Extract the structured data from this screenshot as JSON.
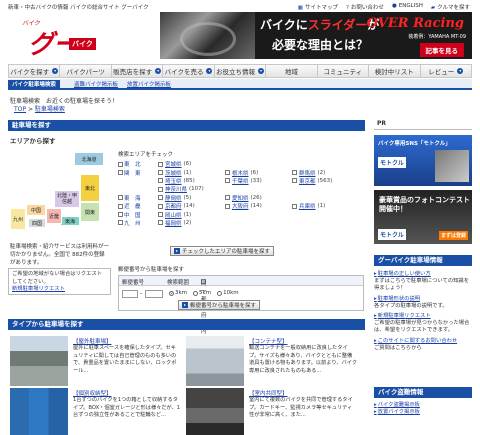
{
  "header": {
    "tagline": "新車・中古バイクの情報 バイクの総合サイト グーバイク",
    "links": [
      {
        "icon": "sitemap-icon",
        "label": "サイトマップ"
      },
      {
        "icon": "help-icon",
        "label": "お問い合わせ"
      },
      {
        "icon": "globe-icon",
        "label": "ENGLISH"
      },
      {
        "icon": "car-icon",
        "label": "クルマを探す"
      }
    ],
    "logo": {
      "small": "バイク",
      "big": "グー",
      "badge": "バイク"
    },
    "banner": {
      "line1_prefix": "バイクに",
      "line1_accent": "スライダー",
      "line1_suffix": "が",
      "line2": "必要な理由とは？",
      "brand": "OVER Racing",
      "caption": "装着例：YAMAHA MT-09",
      "cta": "記事を見る"
    }
  },
  "nav": {
    "items": [
      {
        "label": "バイクを探す",
        "dropdown": true
      },
      {
        "label": "バイクパーツ",
        "dropdown": false
      },
      {
        "label": "販売店を探す",
        "dropdown": true
      },
      {
        "label": "バイクを売る",
        "dropdown": true
      },
      {
        "label": "お役立ち情報",
        "dropdown": true
      },
      {
        "label": "地域",
        "dropdown": false
      },
      {
        "label": "コミュニティ",
        "dropdown": false
      },
      {
        "label": "検討中リスト",
        "dropdown": false
      },
      {
        "label": "レビュー",
        "dropdown": true
      }
    ],
    "subtabs": [
      "バイク駐車場検索",
      "盗難バイク掲示板",
      "放置バイク掲示板"
    ]
  },
  "intro": "駐車場検索　お近くの駐車場を探そう！",
  "breadcrumb": {
    "top": "TOP",
    "sep": ">",
    "current": "駐車場検索"
  },
  "main": {
    "section_title": "駐車場を探す",
    "area_title": "エリアから探す",
    "map": {
      "regions": [
        "北海道",
        "東北",
        "北陸・甲信越",
        "関東",
        "東海",
        "近畿",
        "中国",
        "四国",
        "九州"
      ],
      "colors": {
        "hokkaido": "#9ecae1",
        "tohoku": "#f4d03f",
        "kanto": "#c6e2b3",
        "hokuriku": "#d9c7e8",
        "tokai": "#7fd1c7",
        "kinki": "#f5b7b1",
        "chugoku": "#fad7a0",
        "shikoku": "#d5dbdb",
        "kyushu": "#f9e79f"
      }
    },
    "pref_label": "検索エリアをチェック",
    "pref_rows": [
      {
        "region": "東　北",
        "prefs": [
          {
            "name": "宮城県",
            "count": "(6)"
          }
        ]
      },
      {
        "region": "関　東",
        "prefs": [
          {
            "name": "茨城県",
            "count": "(1)"
          },
          {
            "name": "栃木県",
            "count": "(6)"
          },
          {
            "name": "群馬県",
            "count": "(2)"
          },
          {
            "name": "埼玉県",
            "count": "(85)"
          },
          {
            "name": "千葉県",
            "count": "(33)"
          },
          {
            "name": "東京都",
            "count": "(563)"
          },
          {
            "name": "神奈川県",
            "count": "(107)"
          }
        ]
      },
      {
        "region": "東　海",
        "prefs": [
          {
            "name": "静岡県",
            "count": "(5)"
          },
          {
            "name": "愛知県",
            "count": "(26)"
          }
        ]
      },
      {
        "region": "近　畿",
        "prefs": [
          {
            "name": "京都府",
            "count": "(14)"
          },
          {
            "name": "大阪府",
            "count": "(14)"
          },
          {
            "name": "兵庫県",
            "count": "(1)"
          }
        ]
      },
      {
        "region": "中　国",
        "prefs": [
          {
            "name": "岡山県",
            "count": "(1)"
          }
        ]
      },
      {
        "region": "九　州",
        "prefs": [
          {
            "name": "福岡県",
            "count": "(2)"
          }
        ]
      }
    ],
    "pref_button": "チェックしたエリアの駐車場を探す",
    "info": "駐車場検索・紹介サービスは利用料が一切かかりません。全国で 882件の登録があります。",
    "notice": {
      "text": "ご希望の地域がない場合はリクエストしてください。",
      "link": "新規駐車場リクエスト"
    },
    "zip": {
      "title": "郵便番号から駐車場を探す",
      "col1": "郵便番号",
      "col2": "検索範囲",
      "chk": "同一都道府県内に限定する",
      "dash": "-",
      "radii": [
        "3km",
        "5km",
        "10km"
      ],
      "button": "郵便番号から駐車場を探す"
    },
    "type_title": "タイプから駐車場を探す",
    "types": [
      {
        "title": "【屋外駐車場】",
        "desc": "屋外に駐車スペースを確保したタイプ。セキュリティに関しては自己管理のものも多いので、貴重品を置いたままにしない、ロックポール..."
      },
      {
        "title": "【コンテナ型】",
        "desc": "輸送コンテナを一般収納用に改良したタイプ。サイズも様々あり、バイクとともに整備道具も置ける物もあります。以前より、バイク専用に改良されたものもある..."
      },
      {
        "title": "【個別収納型】",
        "desc": "1台ずつのバイクを1つの箱として収納するタイプ。BOX・個室ガレージと形は様々だが、1台ずつの独立性があることで駐輪など..."
      },
      {
        "title": "【室内共同型】",
        "desc": "室内にて複数のバイクを共同で管理するタイプ。カードキー、監視カメラ等セキュリティ性が非常に高く、また..."
      }
    ]
  },
  "side": {
    "pr": "PR",
    "ad1": {
      "title": "バイク専用SNS「モトクル」",
      "logo": "モトクル"
    },
    "ad2": {
      "title": "豪華賞品のフォトコンテスト開催中！",
      "logo": "モトクル",
      "cta": "まずは登録"
    },
    "info_title": "グーバイク駐車場情報",
    "info_items": [
      {
        "link": "駐車場の正しい使い方",
        "desc": "まずはこちらで駐車場についての知識を得ましょう！"
      },
      {
        "link": "駐車場形状の説明",
        "desc": "各タイプの駐車場の説明です。"
      },
      {
        "link": "新規駐車場リクエスト",
        "desc": "ご希望の駐車場が見つからなかった場合は、希望をリクエストできます。"
      },
      {
        "link": "このサイトに関するお問い合わせ",
        "desc": "ご質問はこちらから"
      }
    ],
    "theft_title": "バイク盗難情報",
    "theft_items": [
      {
        "link": "バイク盗難掲示板"
      },
      {
        "link": "放置バイク掲示板"
      }
    ]
  }
}
